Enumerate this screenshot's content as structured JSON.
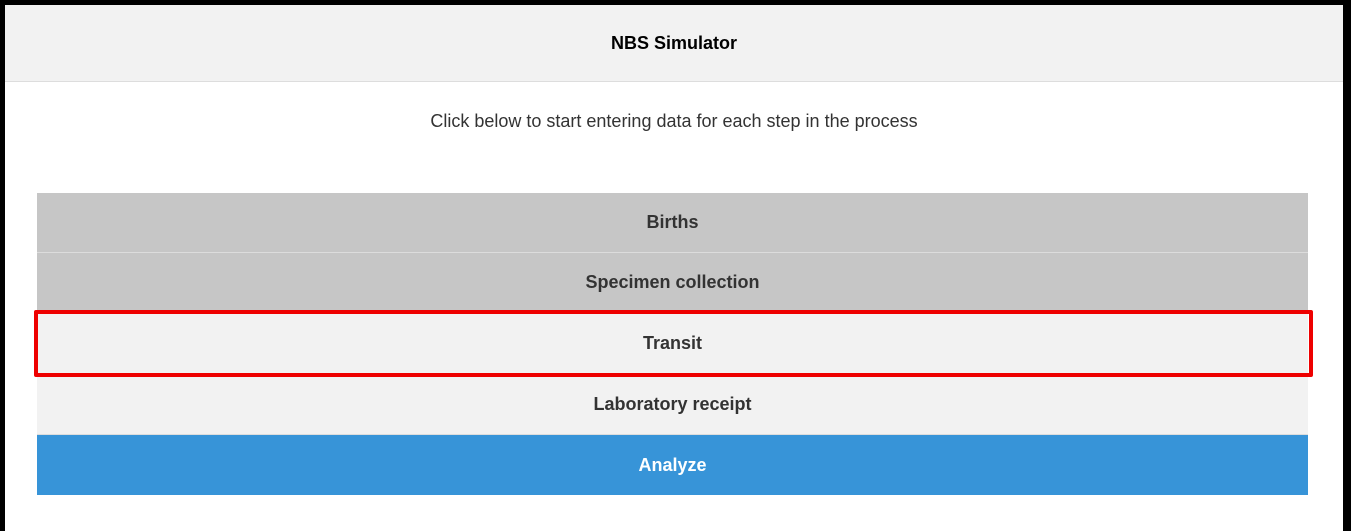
{
  "app": {
    "title": "NBS Simulator"
  },
  "instructions": "Click below to start entering data for each step in the process",
  "steps": [
    {
      "label": "Births",
      "state": "done"
    },
    {
      "label": "Specimen collection",
      "state": "done"
    },
    {
      "label": "Transit",
      "state": "pending",
      "highlighted": true
    },
    {
      "label": "Laboratory receipt",
      "state": "pending"
    }
  ],
  "analyze": {
    "label": "Analyze"
  },
  "colors": {
    "done_step": "#c6c6c6",
    "pending_step": "#f2f2f2",
    "analyze_button": "#3794d8",
    "highlight_border": "#ee0000",
    "outer_border": "#000000"
  }
}
